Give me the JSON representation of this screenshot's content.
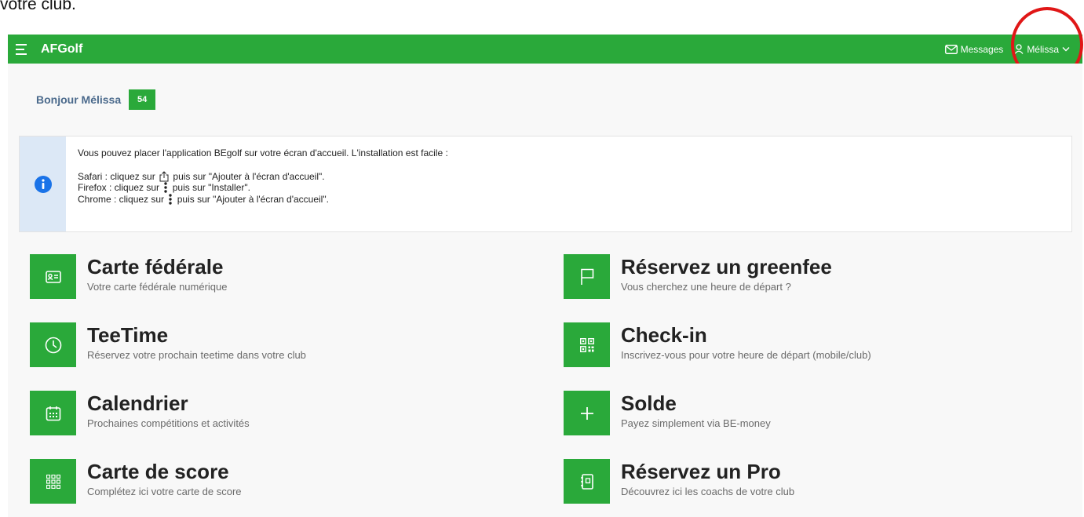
{
  "document_text": "votre club.",
  "app": {
    "title": "AFGolf"
  },
  "nav": {
    "messages": "Messages",
    "user": "Mélissa"
  },
  "greeting": {
    "text": "Bonjour Mélissa",
    "handicap": "54"
  },
  "alert": {
    "intro": "Vous pouvez placer l'application BEgolf sur votre écran d'accueil. L'installation est facile :",
    "safari_prefix": "Safari : cliquez sur",
    "safari_suffix": "puis sur \"Ajouter à l'écran d'accueil\".",
    "firefox_prefix": "Firefox : cliquez sur",
    "firefox_suffix": "puis sur \"Installer\".",
    "chrome_prefix": "Chrome : cliquez sur",
    "chrome_suffix": "puis sur \"Ajouter à l'écran d'accueil\"."
  },
  "tiles": [
    {
      "title": "Carte fédérale",
      "subtitle": "Votre carte fédérale numérique",
      "icon": "id-card-icon"
    },
    {
      "title": "Réservez un greenfee",
      "subtitle": "Vous cherchez une heure de départ ?",
      "icon": "flag-icon"
    },
    {
      "title": "TeeTime",
      "subtitle": "Réservez votre prochain teetime dans votre club",
      "icon": "clock-icon"
    },
    {
      "title": "Check-in",
      "subtitle": "Inscrivez-vous pour votre heure de départ (mobile/club)",
      "icon": "qr-code-icon"
    },
    {
      "title": "Calendrier",
      "subtitle": "Prochaines compétitions et activités",
      "icon": "calendar-icon"
    },
    {
      "title": "Solde",
      "subtitle": "Payez simplement via BE-money",
      "icon": "plus-icon"
    },
    {
      "title": "Carte de score",
      "subtitle": "Complétez ici votre carte de score",
      "icon": "grid-icon"
    },
    {
      "title": "Réservez un Pro",
      "subtitle": "Découvrez ici les coachs de votre club",
      "icon": "notebook-icon"
    }
  ],
  "colors": {
    "brand_green": "#2aa93a",
    "annotation_red": "#e01717",
    "info_blue": "#1a73e8"
  }
}
